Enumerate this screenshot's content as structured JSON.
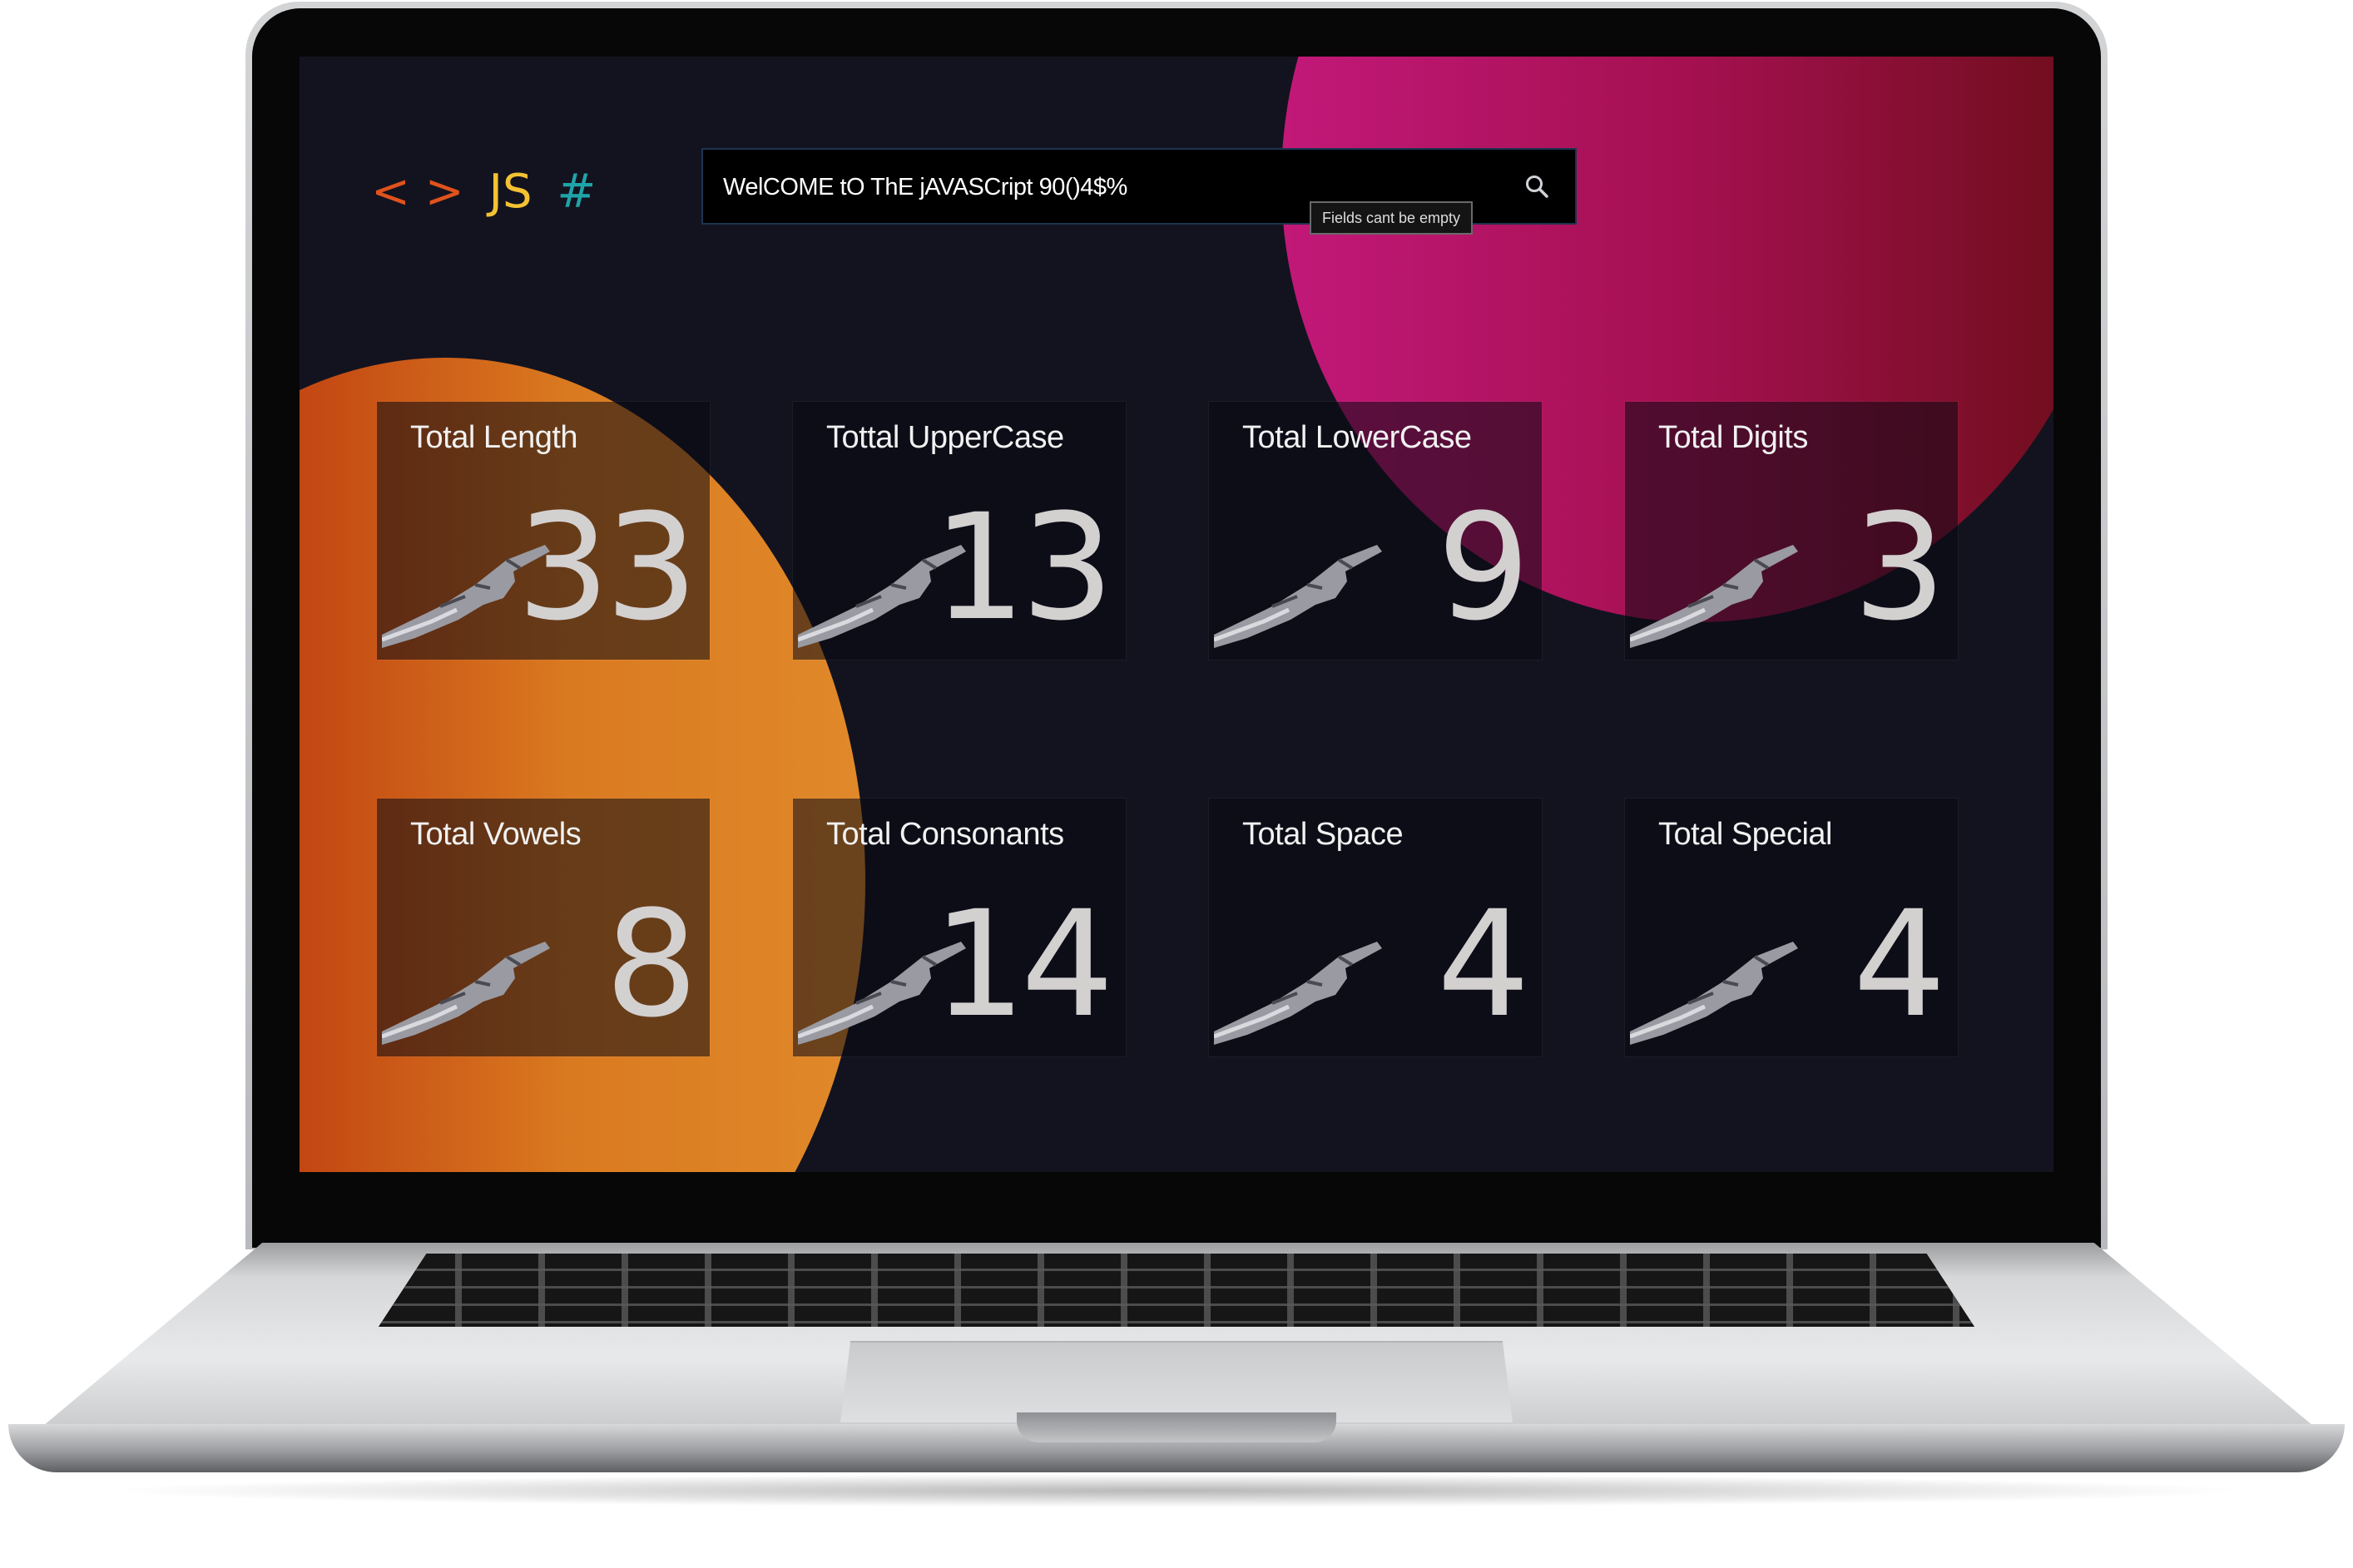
{
  "logo": {
    "open": "<",
    "close": ">",
    "js": "JS",
    "hash": "#"
  },
  "search": {
    "value": "WelCOME tO ThE jAVASCript 90()4$%",
    "icon": "search-icon"
  },
  "tooltip": {
    "text": "Fields cant be empty"
  },
  "cards": [
    {
      "label": "Total Length",
      "value": "33"
    },
    {
      "label": "Tottal UpperCase",
      "value": "13"
    },
    {
      "label": "Total LowerCase",
      "value": "9"
    },
    {
      "label": "Total Digits",
      "value": "3"
    },
    {
      "label": "Total Vowels",
      "value": "8"
    },
    {
      "label": "Total Consonants",
      "value": "14"
    },
    {
      "label": "Total Space",
      "value": "4"
    },
    {
      "label": "Total Special",
      "value": "4"
    }
  ],
  "card_icon": "robot-hand-icon",
  "colors": {
    "background": "#13131f",
    "orange_blob": "#da7a20",
    "pink_blob": "#c21879",
    "logo_brackets": "#e0521c",
    "logo_js": "#f3c232",
    "logo_hash": "#1fa4a8"
  }
}
